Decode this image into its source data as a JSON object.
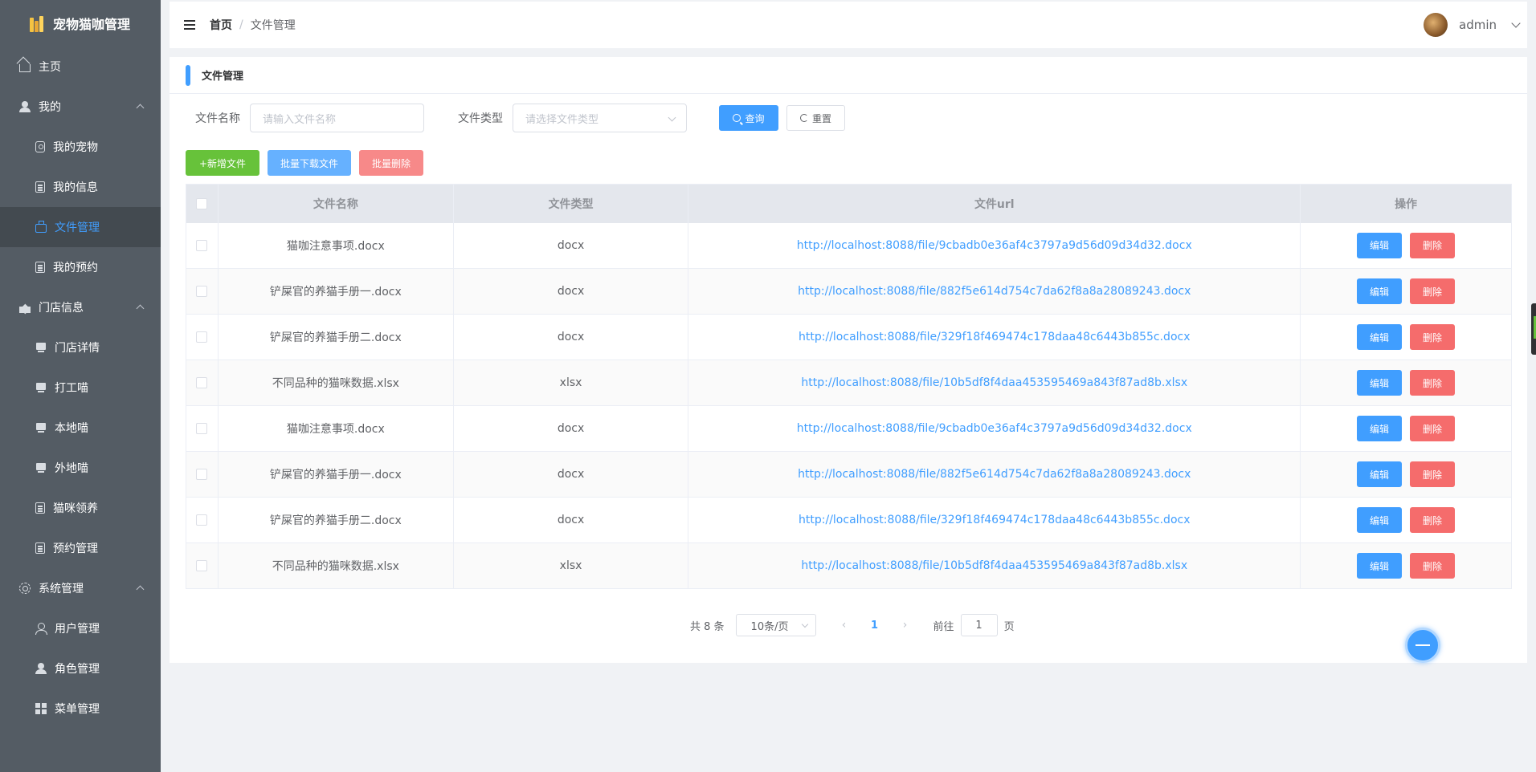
{
  "app": {
    "title": "宠物猫咖管理"
  },
  "sidebar": {
    "items": [
      {
        "label": "主页",
        "icon": "home-icon",
        "level": 0
      },
      {
        "label": "我的",
        "icon": "user-icon",
        "level": 0,
        "group": true
      },
      {
        "label": "我的宠物",
        "icon": "pet-icon",
        "level": 1
      },
      {
        "label": "我的信息",
        "icon": "doc-icon",
        "level": 1
      },
      {
        "label": "文件管理",
        "icon": "briefcase-icon",
        "level": 1,
        "active": true
      },
      {
        "label": "我的预约",
        "icon": "doc-icon",
        "level": 1
      },
      {
        "label": "门店信息",
        "icon": "shop-icon",
        "level": 0,
        "group": true
      },
      {
        "label": "门店详情",
        "icon": "monitor-icon",
        "level": 1
      },
      {
        "label": "打工喵",
        "icon": "monitor-icon",
        "level": 1
      },
      {
        "label": "本地喵",
        "icon": "monitor-icon",
        "level": 1
      },
      {
        "label": "外地喵",
        "icon": "monitor-icon",
        "level": 1
      },
      {
        "label": "猫咪领养",
        "icon": "doc-icon",
        "level": 1
      },
      {
        "label": "预约管理",
        "icon": "doc-icon",
        "level": 1
      },
      {
        "label": "系统管理",
        "icon": "gear-icon",
        "level": 0,
        "group": true
      },
      {
        "label": "用户管理",
        "icon": "user-outline-icon",
        "level": 1
      },
      {
        "label": "角色管理",
        "icon": "user-icon",
        "level": 1
      },
      {
        "label": "菜单管理",
        "icon": "grid-icon",
        "level": 1
      }
    ]
  },
  "header": {
    "breadcrumb": {
      "home": "首页",
      "separator": "/",
      "current": "文件管理"
    },
    "user": {
      "name": "admin"
    }
  },
  "page": {
    "title": "文件管理",
    "filters": {
      "name_label": "文件名称",
      "name_placeholder": "请输入文件名称",
      "type_label": "文件类型",
      "type_placeholder": "请选择文件类型",
      "search_label": "查询",
      "reset_label": "重置"
    },
    "actions": {
      "add_label": "+新增文件",
      "batch_download_label": "批量下载文件",
      "batch_delete_label": "批量删除"
    },
    "table": {
      "columns": [
        "文件名称",
        "文件类型",
        "文件url",
        "操作"
      ],
      "edit_label": "编辑",
      "delete_label": "删除",
      "rows": [
        {
          "name": "猫咖注意事项.docx",
          "type": "docx",
          "url": "http://localhost:8088/file/9cbadb0e36af4c3797a9d56d09d34d32.docx"
        },
        {
          "name": "铲屎官的养猫手册一.docx",
          "type": "docx",
          "url": "http://localhost:8088/file/882f5e614d754c7da62f8a8a28089243.docx"
        },
        {
          "name": "铲屎官的养猫手册二.docx",
          "type": "docx",
          "url": "http://localhost:8088/file/329f18f469474c178daa48c6443b855c.docx"
        },
        {
          "name": "不同品种的猫咪数据.xlsx",
          "type": "xlsx",
          "url": "http://localhost:8088/file/10b5df8f4daa453595469a843f87ad8b.xlsx"
        },
        {
          "name": "猫咖注意事项.docx",
          "type": "docx",
          "url": "http://localhost:8088/file/9cbadb0e36af4c3797a9d56d09d34d32.docx"
        },
        {
          "name": "铲屎官的养猫手册一.docx",
          "type": "docx",
          "url": "http://localhost:8088/file/882f5e614d754c7da62f8a8a28089243.docx"
        },
        {
          "name": "铲屎官的养猫手册二.docx",
          "type": "docx",
          "url": "http://localhost:8088/file/329f18f469474c178daa48c6443b855c.docx"
        },
        {
          "name": "不同品种的猫咪数据.xlsx",
          "type": "xlsx",
          "url": "http://localhost:8088/file/10b5df8f4daa453595469a843f87ad8b.xlsx"
        }
      ]
    },
    "pagination": {
      "total_text": "共 8 条",
      "page_size": "10条/页",
      "current_page": "1",
      "goto_prefix": "前往",
      "goto_value": "1",
      "goto_suffix": "页",
      "prev_icon": "‹",
      "next_icon": "›"
    }
  },
  "colors": {
    "sidebar_bg": "#545c64",
    "primary": "#409eff",
    "success": "#67c23a",
    "danger": "#f56c6c"
  }
}
